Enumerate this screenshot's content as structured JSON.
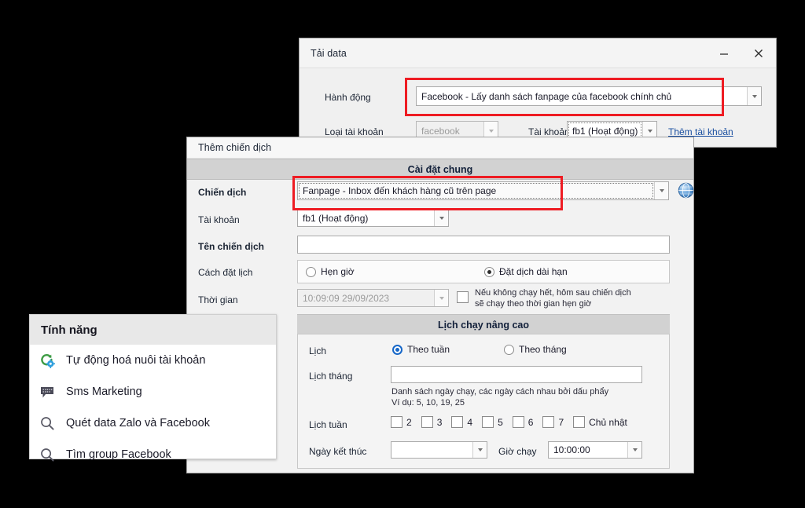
{
  "background_color": "#000000",
  "accent_red": "#ee1c23",
  "link_color": "#1a4fa0",
  "download_dialog": {
    "title": "Tải data",
    "minimize_label": "–",
    "close_label": "×",
    "action_row": {
      "label": "Hành động",
      "value": "Facebook - Lấy danh sách fanpage của facebook chính chủ"
    },
    "account_type_row": {
      "label": "Loại tài khoản",
      "value": "facebook"
    },
    "account_row": {
      "label": "Tài khoản",
      "value": "fb1 (Hoạt động)"
    },
    "add_account_link": "Thêm tài khoản"
  },
  "campaign_dialog": {
    "title": "Thêm chiến dịch",
    "general_section_title": "Cài đặt chung",
    "campaign_row": {
      "label": "Chiến dịch",
      "value": "Fanpage - Inbox đến khách hàng cũ trên page"
    },
    "globe_icon": "globe-help-icon",
    "account_row": {
      "label": "Tài khoản",
      "value": "fb1 (Hoạt động)"
    },
    "campaign_name_row": {
      "label": "Tên chiến dịch",
      "value": "",
      "placeholder": ""
    },
    "schedule_mode_row": {
      "label": "Cách đặt lịch",
      "options": [
        {
          "label": "Hẹn giờ",
          "selected": false
        },
        {
          "label": "Đặt dịch dài hạn",
          "selected": true
        }
      ]
    },
    "time_row": {
      "label": "Thời gian",
      "value": "10:09:09 29/09/2023",
      "checkbox_checked": false,
      "note_line1": "Nếu không chạy hết, hôm sau chiến dịch",
      "note_line2": "sẽ chạy theo thời gian hẹn giờ"
    },
    "advanced_section_title": "Lịch chạy nâng cao",
    "schedule_row": {
      "label": "Lịch",
      "options": [
        {
          "label": "Theo tuần",
          "selected": true
        },
        {
          "label": "Theo tháng",
          "selected": false
        }
      ]
    },
    "month_schedule_row": {
      "label": "Lịch tháng",
      "value": "",
      "hint_line1": "Danh sách ngày chạy, các ngày cách nhau bởi dấu phẩy",
      "hint_line2": "Ví dụ: 5, 10, 19, 25"
    },
    "week_schedule_row": {
      "label": "Lịch tuần",
      "days": [
        {
          "label": "2",
          "checked": false
        },
        {
          "label": "3",
          "checked": false
        },
        {
          "label": "4",
          "checked": false
        },
        {
          "label": "5",
          "checked": false
        },
        {
          "label": "6",
          "checked": false
        },
        {
          "label": "7",
          "checked": false
        },
        {
          "label": "Chủ nhật",
          "checked": false
        }
      ]
    },
    "end_date_row": {
      "label": "Ngày kết thúc",
      "value": ""
    },
    "run_time_row": {
      "label": "Giờ chạy",
      "value": "10:00:00"
    }
  },
  "features_panel": {
    "header": "Tính năng",
    "items": [
      {
        "icon": "sync-gear-icon",
        "label": "Tự động hoá nuôi tài khoản"
      },
      {
        "icon": "speech-bubble-icon",
        "label": "Sms Marketing"
      },
      {
        "icon": "search-icon",
        "label": "Quét data Zalo và Facebook"
      },
      {
        "icon": "search-icon",
        "label": "Tìm group Facebook"
      }
    ]
  }
}
